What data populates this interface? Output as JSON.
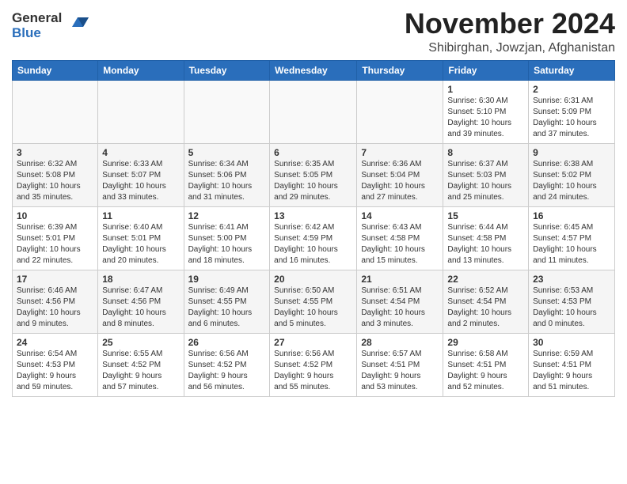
{
  "header": {
    "logo_line1": "General",
    "logo_line2": "Blue",
    "month": "November 2024",
    "location": "Shibirghan, Jowzjan, Afghanistan"
  },
  "weekdays": [
    "Sunday",
    "Monday",
    "Tuesday",
    "Wednesday",
    "Thursday",
    "Friday",
    "Saturday"
  ],
  "weeks": [
    [
      {
        "day": "",
        "info": ""
      },
      {
        "day": "",
        "info": ""
      },
      {
        "day": "",
        "info": ""
      },
      {
        "day": "",
        "info": ""
      },
      {
        "day": "",
        "info": ""
      },
      {
        "day": "1",
        "info": "Sunrise: 6:30 AM\nSunset: 5:10 PM\nDaylight: 10 hours\nand 39 minutes."
      },
      {
        "day": "2",
        "info": "Sunrise: 6:31 AM\nSunset: 5:09 PM\nDaylight: 10 hours\nand 37 minutes."
      }
    ],
    [
      {
        "day": "3",
        "info": "Sunrise: 6:32 AM\nSunset: 5:08 PM\nDaylight: 10 hours\nand 35 minutes."
      },
      {
        "day": "4",
        "info": "Sunrise: 6:33 AM\nSunset: 5:07 PM\nDaylight: 10 hours\nand 33 minutes."
      },
      {
        "day": "5",
        "info": "Sunrise: 6:34 AM\nSunset: 5:06 PM\nDaylight: 10 hours\nand 31 minutes."
      },
      {
        "day": "6",
        "info": "Sunrise: 6:35 AM\nSunset: 5:05 PM\nDaylight: 10 hours\nand 29 minutes."
      },
      {
        "day": "7",
        "info": "Sunrise: 6:36 AM\nSunset: 5:04 PM\nDaylight: 10 hours\nand 27 minutes."
      },
      {
        "day": "8",
        "info": "Sunrise: 6:37 AM\nSunset: 5:03 PM\nDaylight: 10 hours\nand 25 minutes."
      },
      {
        "day": "9",
        "info": "Sunrise: 6:38 AM\nSunset: 5:02 PM\nDaylight: 10 hours\nand 24 minutes."
      }
    ],
    [
      {
        "day": "10",
        "info": "Sunrise: 6:39 AM\nSunset: 5:01 PM\nDaylight: 10 hours\nand 22 minutes."
      },
      {
        "day": "11",
        "info": "Sunrise: 6:40 AM\nSunset: 5:01 PM\nDaylight: 10 hours\nand 20 minutes."
      },
      {
        "day": "12",
        "info": "Sunrise: 6:41 AM\nSunset: 5:00 PM\nDaylight: 10 hours\nand 18 minutes."
      },
      {
        "day": "13",
        "info": "Sunrise: 6:42 AM\nSunset: 4:59 PM\nDaylight: 10 hours\nand 16 minutes."
      },
      {
        "day": "14",
        "info": "Sunrise: 6:43 AM\nSunset: 4:58 PM\nDaylight: 10 hours\nand 15 minutes."
      },
      {
        "day": "15",
        "info": "Sunrise: 6:44 AM\nSunset: 4:58 PM\nDaylight: 10 hours\nand 13 minutes."
      },
      {
        "day": "16",
        "info": "Sunrise: 6:45 AM\nSunset: 4:57 PM\nDaylight: 10 hours\nand 11 minutes."
      }
    ],
    [
      {
        "day": "17",
        "info": "Sunrise: 6:46 AM\nSunset: 4:56 PM\nDaylight: 10 hours\nand 9 minutes."
      },
      {
        "day": "18",
        "info": "Sunrise: 6:47 AM\nSunset: 4:56 PM\nDaylight: 10 hours\nand 8 minutes."
      },
      {
        "day": "19",
        "info": "Sunrise: 6:49 AM\nSunset: 4:55 PM\nDaylight: 10 hours\nand 6 minutes."
      },
      {
        "day": "20",
        "info": "Sunrise: 6:50 AM\nSunset: 4:55 PM\nDaylight: 10 hours\nand 5 minutes."
      },
      {
        "day": "21",
        "info": "Sunrise: 6:51 AM\nSunset: 4:54 PM\nDaylight: 10 hours\nand 3 minutes."
      },
      {
        "day": "22",
        "info": "Sunrise: 6:52 AM\nSunset: 4:54 PM\nDaylight: 10 hours\nand 2 minutes."
      },
      {
        "day": "23",
        "info": "Sunrise: 6:53 AM\nSunset: 4:53 PM\nDaylight: 10 hours\nand 0 minutes."
      }
    ],
    [
      {
        "day": "24",
        "info": "Sunrise: 6:54 AM\nSunset: 4:53 PM\nDaylight: 9 hours\nand 59 minutes."
      },
      {
        "day": "25",
        "info": "Sunrise: 6:55 AM\nSunset: 4:52 PM\nDaylight: 9 hours\nand 57 minutes."
      },
      {
        "day": "26",
        "info": "Sunrise: 6:56 AM\nSunset: 4:52 PM\nDaylight: 9 hours\nand 56 minutes."
      },
      {
        "day": "27",
        "info": "Sunrise: 6:56 AM\nSunset: 4:52 PM\nDaylight: 9 hours\nand 55 minutes."
      },
      {
        "day": "28",
        "info": "Sunrise: 6:57 AM\nSunset: 4:51 PM\nDaylight: 9 hours\nand 53 minutes."
      },
      {
        "day": "29",
        "info": "Sunrise: 6:58 AM\nSunset: 4:51 PM\nDaylight: 9 hours\nand 52 minutes."
      },
      {
        "day": "30",
        "info": "Sunrise: 6:59 AM\nSunset: 4:51 PM\nDaylight: 9 hours\nand 51 minutes."
      }
    ]
  ]
}
